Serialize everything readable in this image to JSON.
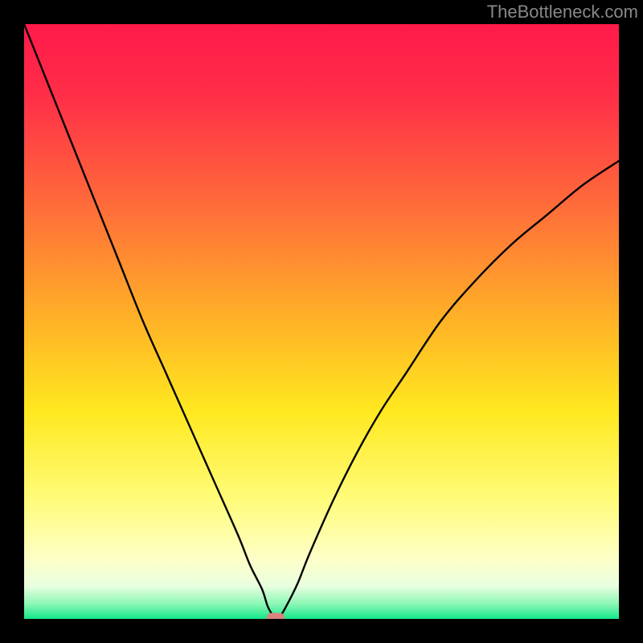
{
  "watermark": "TheBottleneck.com",
  "chart_data": {
    "type": "line",
    "title": "",
    "xlabel": "",
    "ylabel": "",
    "xlim": [
      0,
      100
    ],
    "ylim": [
      0,
      100
    ],
    "background_gradient": {
      "stops": [
        {
          "offset": 0.0,
          "color": "#ff1a4a"
        },
        {
          "offset": 0.12,
          "color": "#ff2e48"
        },
        {
          "offset": 0.3,
          "color": "#ff6a3a"
        },
        {
          "offset": 0.5,
          "color": "#ffb327"
        },
        {
          "offset": 0.65,
          "color": "#ffe81f"
        },
        {
          "offset": 0.8,
          "color": "#fffc7a"
        },
        {
          "offset": 0.9,
          "color": "#fdffc8"
        },
        {
          "offset": 0.945,
          "color": "#e9ffdf"
        },
        {
          "offset": 0.975,
          "color": "#8bf7b5"
        },
        {
          "offset": 1.0,
          "color": "#14e78a"
        }
      ]
    },
    "series": [
      {
        "name": "bottleneck-curve",
        "type": "line",
        "x": [
          0,
          4,
          8,
          12,
          16,
          20,
          24,
          28,
          32,
          36,
          38,
          40,
          41,
          42,
          43,
          44,
          46,
          48,
          52,
          56,
          60,
          64,
          70,
          76,
          82,
          88,
          94,
          100
        ],
        "y": [
          100,
          90,
          80,
          70,
          60,
          50,
          41,
          32,
          23,
          14,
          9,
          5,
          2,
          0.5,
          0.5,
          2,
          6,
          11,
          20,
          28,
          35,
          41,
          50,
          57,
          63,
          68,
          73,
          77
        ]
      }
    ],
    "marker": {
      "x": 42.3,
      "y": 0.2,
      "color": "#d9837f",
      "width": 3.0,
      "height": 1.6
    }
  }
}
